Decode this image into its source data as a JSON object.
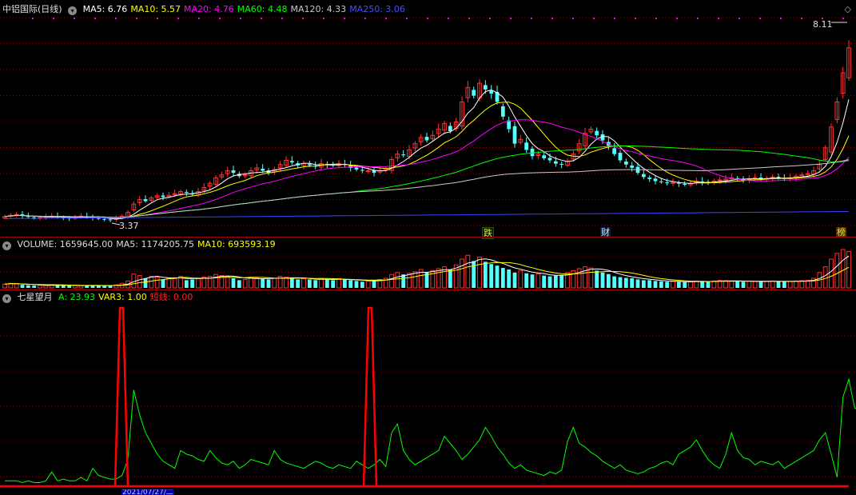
{
  "colors": {
    "up": "#ff3232",
    "down": "#54ffff",
    "ma5": "#ffffff",
    "ma10": "#ffff00",
    "ma20": "#ff00ff",
    "ma60": "#00ff00",
    "ma120": "#c8c8c8",
    "ma250": "#4040ff",
    "grid": "#8b0000",
    "a": "#00ff00",
    "short": "#ff0000"
  },
  "main": {
    "title": "中铝国际(日线)",
    "indicators": [
      {
        "label": "MA5: 6.76",
        "color": "#ffffff"
      },
      {
        "label": "MA10: 5.57",
        "color": "#ffff00"
      },
      {
        "label": "MA20: 4.76",
        "color": "#ff00ff"
      },
      {
        "label": "MA60: 4.48",
        "color": "#00ff00"
      },
      {
        "label": "MA120: 4.33",
        "color": "#c8c8c8"
      },
      {
        "label": "MA250: 3.06",
        "color": "#4a4aff"
      }
    ],
    "high_label": "8.11",
    "low_label": "3.37",
    "tags": [
      "跌",
      "财",
      "榜"
    ]
  },
  "volume": {
    "indicators": [
      {
        "label": "VOLUME: 1659645.00",
        "color": "#dddddd"
      },
      {
        "label": "MA5: 1174205.75",
        "color": "#dddddd"
      },
      {
        "label": "MA10: 693593.19",
        "color": "#ffff00"
      }
    ]
  },
  "indicator": {
    "name": "七星望月",
    "values": [
      {
        "label": "A: 23.93",
        "color": "#00ff00"
      },
      {
        "label": "VAR3: 1.00",
        "color": "#ffff00"
      },
      {
        "label": "短线: 0.00",
        "color": "#ff2020"
      }
    ],
    "date_label": "2021/07/27/二"
  },
  "chart_data": {
    "type": "candlestick",
    "price_range": [
      3.37,
      8.11
    ],
    "close": [
      3.45,
      3.48,
      3.5,
      3.47,
      3.44,
      3.42,
      3.43,
      3.45,
      3.46,
      3.44,
      3.42,
      3.41,
      3.43,
      3.46,
      3.45,
      3.42,
      3.4,
      3.38,
      3.37,
      3.4,
      3.46,
      3.55,
      3.75,
      3.86,
      3.82,
      3.9,
      3.95,
      3.92,
      3.96,
      4.0,
      4.05,
      4.02,
      3.98,
      4.05,
      4.15,
      4.25,
      4.38,
      4.45,
      4.55,
      4.5,
      4.42,
      4.45,
      4.55,
      4.62,
      4.55,
      4.5,
      4.58,
      4.7,
      4.8,
      4.75,
      4.68,
      4.72,
      4.68,
      4.65,
      4.72,
      4.7,
      4.68,
      4.72,
      4.7,
      4.62,
      4.58,
      4.55,
      4.55,
      4.5,
      4.56,
      4.6,
      4.82,
      4.95,
      4.92,
      5.05,
      5.2,
      5.35,
      5.28,
      5.4,
      5.55,
      5.68,
      5.5,
      5.72,
      6.2,
      6.55,
      6.35,
      6.65,
      6.5,
      6.4,
      6.2,
      5.85,
      5.55,
      5.2,
      5.3,
      5.05,
      4.9,
      4.95,
      4.85,
      4.8,
      4.72,
      4.7,
      4.78,
      4.95,
      5.2,
      5.45,
      5.55,
      5.4,
      5.28,
      5.15,
      4.95,
      4.8,
      4.7,
      4.62,
      4.5,
      4.4,
      4.35,
      4.3,
      4.28,
      4.25,
      4.27,
      4.24,
      4.22,
      4.25,
      4.3,
      4.28,
      4.25,
      4.3,
      4.33,
      4.35,
      4.38,
      4.35,
      4.33,
      4.36,
      4.38,
      4.35,
      4.37,
      4.4,
      4.38,
      4.36,
      4.38,
      4.42,
      4.45,
      4.48,
      4.55,
      4.7,
      5.1,
      5.6,
      6.2,
      6.9,
      7.5
    ],
    "volume_max": 1659645.0,
    "volume": [
      0.1,
      0.12,
      0.11,
      0.08,
      0.07,
      0.06,
      0.07,
      0.06,
      0.08,
      0.07,
      0.06,
      0.07,
      0.06,
      0.05,
      0.06,
      0.07,
      0.06,
      0.05,
      0.06,
      0.08,
      0.12,
      0.18,
      0.36,
      0.32,
      0.25,
      0.3,
      0.28,
      0.22,
      0.26,
      0.24,
      0.3,
      0.2,
      0.22,
      0.25,
      0.28,
      0.3,
      0.35,
      0.32,
      0.3,
      0.25,
      0.2,
      0.22,
      0.28,
      0.26,
      0.24,
      0.22,
      0.25,
      0.3,
      0.28,
      0.26,
      0.22,
      0.24,
      0.22,
      0.2,
      0.25,
      0.22,
      0.2,
      0.24,
      0.22,
      0.2,
      0.18,
      0.16,
      0.18,
      0.2,
      0.22,
      0.25,
      0.35,
      0.4,
      0.35,
      0.38,
      0.42,
      0.48,
      0.4,
      0.45,
      0.5,
      0.55,
      0.48,
      0.6,
      0.75,
      0.85,
      0.7,
      0.8,
      0.68,
      0.62,
      0.58,
      0.52,
      0.48,
      0.4,
      0.45,
      0.38,
      0.35,
      0.36,
      0.32,
      0.3,
      0.32,
      0.34,
      0.4,
      0.45,
      0.5,
      0.55,
      0.52,
      0.45,
      0.4,
      0.36,
      0.3,
      0.28,
      0.26,
      0.25,
      0.22,
      0.2,
      0.2,
      0.18,
      0.17,
      0.16,
      0.17,
      0.16,
      0.15,
      0.16,
      0.18,
      0.17,
      0.16,
      0.18,
      0.2,
      0.19,
      0.18,
      0.17,
      0.16,
      0.18,
      0.17,
      0.16,
      0.17,
      0.18,
      0.17,
      0.16,
      0.17,
      0.18,
      0.19,
      0.2,
      0.25,
      0.4,
      0.55,
      0.75,
      0.9,
      1.0,
      0.95
    ],
    "indicator_A": [
      3,
      3,
      3,
      2,
      3,
      2,
      2,
      3,
      8,
      3,
      4,
      3,
      3,
      5,
      3,
      10,
      6,
      5,
      4,
      4,
      6,
      15,
      54,
      40,
      30,
      24,
      18,
      14,
      12,
      10,
      20,
      18,
      17,
      15,
      14,
      20,
      16,
      13,
      12,
      14,
      10,
      12,
      15,
      14,
      13,
      12,
      20,
      15,
      13,
      12,
      11,
      10,
      12,
      14,
      13,
      11,
      10,
      12,
      11,
      10,
      14,
      12,
      10,
      12,
      15,
      11,
      30,
      35,
      20,
      15,
      12,
      14,
      16,
      18,
      20,
      28,
      24,
      20,
      15,
      18,
      22,
      26,
      33,
      28,
      22,
      18,
      13,
      10,
      12,
      9,
      8,
      7,
      6,
      8,
      7,
      9,
      25,
      33,
      24,
      22,
      19,
      17,
      14,
      12,
      10,
      12,
      9,
      8,
      7,
      8,
      10,
      11,
      13,
      14,
      12,
      18,
      20,
      22,
      26,
      20,
      15,
      12,
      10,
      18,
      30,
      20,
      16,
      15,
      12,
      14,
      13,
      12,
      14,
      10,
      12,
      14,
      16,
      18,
      20,
      26,
      30,
      18,
      5,
      50,
      60,
      44,
      42
    ]
  }
}
